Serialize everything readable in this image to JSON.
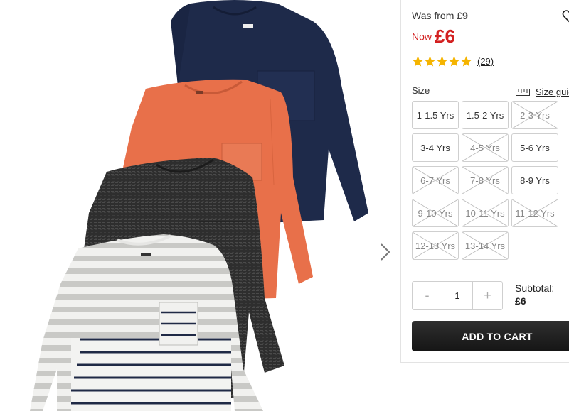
{
  "pricing": {
    "was_label": "Was from",
    "was_value": "£9",
    "now_label": "Now",
    "now_value": "£6",
    "now_color": "#d32020"
  },
  "rating": {
    "stars": 5,
    "max_stars": 5,
    "review_count": "(29)",
    "star_color": "#f5b400"
  },
  "size": {
    "label": "Size",
    "guide_label": "Size guide",
    "guide_icon": "ruler-icon",
    "options": [
      {
        "label": "1-1.5 Yrs",
        "available": true
      },
      {
        "label": "1.5-2 Yrs",
        "available": true
      },
      {
        "label": "2-3 Yrs",
        "available": false
      },
      {
        "label": "3-4 Yrs",
        "available": true
      },
      {
        "label": "4-5 Yrs",
        "available": false
      },
      {
        "label": "5-6 Yrs",
        "available": true
      },
      {
        "label": "6-7 Yrs",
        "available": false
      },
      {
        "label": "7-8 Yrs",
        "available": false
      },
      {
        "label": "8-9 Yrs",
        "available": true
      },
      {
        "label": "9-10 Yrs",
        "available": false
      },
      {
        "label": "10-11 Yrs",
        "available": false
      },
      {
        "label": "11-12 Yrs",
        "available": false
      },
      {
        "label": "12-13 Yrs",
        "available": false
      },
      {
        "label": "13-14 Yrs",
        "available": false
      }
    ]
  },
  "quantity": {
    "minus": "-",
    "value": "1",
    "plus": "+"
  },
  "subtotal": {
    "label": "Subtotal:",
    "value": "£6"
  },
  "cart": {
    "button_label": "ADD TO CART"
  },
  "product_image": {
    "description_icons": [
      "navy-tshirt",
      "orange-tshirt",
      "charcoal-tshirt",
      "striped-tshirt"
    ],
    "next_icon": "chevron-right-icon"
  }
}
